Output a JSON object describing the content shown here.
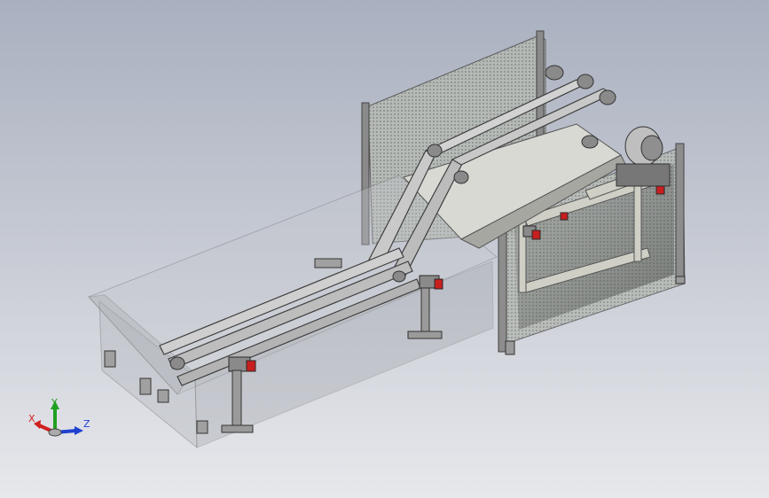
{
  "app": {
    "view": "isometric-3d-model-view"
  },
  "model": {
    "description_tag": "conveyor-assembly"
  },
  "triad": {
    "x_label": "X",
    "y_label": "Y",
    "z_label": "Z",
    "colors": {
      "x": "#d02020",
      "y": "#20a020",
      "z": "#2040d0"
    }
  },
  "colors": {
    "background_top": "#a9b0bf",
    "background_bottom": "#e7e8ec",
    "frame": "#6e6e6e",
    "glass": "#b9bcc3",
    "motor": "#c81e1e",
    "mesh": "#9aa09a"
  }
}
